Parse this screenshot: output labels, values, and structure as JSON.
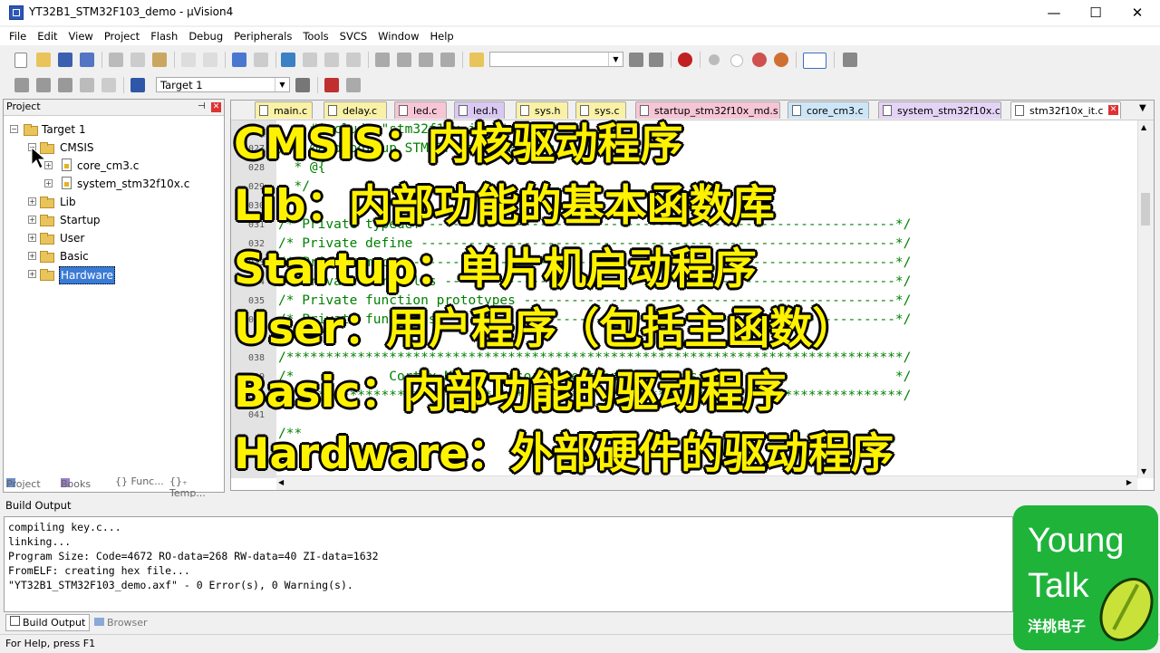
{
  "window": {
    "title": "YT32B1_STM32F103_demo - µVision4",
    "minimize": "—",
    "maximize": "☐",
    "close": "✕"
  },
  "menu": [
    "File",
    "Edit",
    "View",
    "Project",
    "Flash",
    "Debug",
    "Peripherals",
    "Tools",
    "SVCS",
    "Window",
    "Help"
  ],
  "toolbar2": {
    "target": "Target 1"
  },
  "project_panel": {
    "title": "Project",
    "tree": [
      {
        "label": "Target 1"
      },
      {
        "label": "CMSIS"
      },
      {
        "label": "core_cm3.c"
      },
      {
        "label": "system_stm32f10x.c"
      },
      {
        "label": "Lib"
      },
      {
        "label": "Startup"
      },
      {
        "label": "User"
      },
      {
        "label": "Basic"
      },
      {
        "label": "Hardware"
      }
    ],
    "tabs": [
      "Project",
      "Books",
      "{} Func...",
      "{}₊ Temp..."
    ]
  },
  "editor": {
    "tabs": [
      {
        "label": "main.c",
        "color": "#f9f1a6"
      },
      {
        "label": "delay.c",
        "color": "#f9f1a6"
      },
      {
        "label": "led.c",
        "color": "#f6c5d6"
      },
      {
        "label": "led.h",
        "color": "#d9c9f2"
      },
      {
        "label": "sys.h",
        "color": "#f9f1a6"
      },
      {
        "label": "sys.c",
        "color": "#f9f1a6"
      },
      {
        "label": "startup_stm32f10x_md.s",
        "color": "#f6c5d6"
      },
      {
        "label": "core_cm3.c",
        "color": "#cde6f7"
      },
      {
        "label": "system_stm32f10x.c",
        "color": "#e3d3f4"
      },
      {
        "label": "stm32f10x_it.c",
        "color": "#ffffff"
      }
    ],
    "lines": [
      {
        "num": "",
        "text": "    #include \"stm32f10x_it.h\""
      },
      {
        "num": "027",
        "text": "/** @addtogroup STM32F10x_StdPeriph_Template"
      },
      {
        "num": "028",
        "text": "  * @{"
      },
      {
        "num": "029",
        "text": "  */"
      },
      {
        "num": "030",
        "text": ""
      },
      {
        "num": "031",
        "text": "/* Private typedef -----------------------------------------------------------*/"
      },
      {
        "num": "032",
        "text": "/* Private define ------------------------------------------------------------*/"
      },
      {
        "num": "033",
        "text": "/* Private macro -------------------------------------------------------------*/"
      },
      {
        "num": "034",
        "text": "/* Private variables ---------------------------------------------------------*/"
      },
      {
        "num": "035",
        "text": "/* Private function prototypes -----------------------------------------------*/"
      },
      {
        "num": "036",
        "text": "/* Private functions ---------------------------------------------------------*/"
      },
      {
        "num": "037",
        "text": ""
      },
      {
        "num": "038",
        "text": "/******************************************************************************/"
      },
      {
        "num": "039",
        "text": "/*            Cortex-M3 Processor Exceptions Handlers                         */"
      },
      {
        "num": "040",
        "text": "/******************************************************************************/"
      },
      {
        "num": "041",
        "text": ""
      },
      {
        "num": "",
        "text": "/**"
      }
    ]
  },
  "overlay": [
    "CMSIS：内核驱动程序",
    "Lib：内部功能的基本函数库",
    "Startup：单片机启动程序",
    "User：用户程序（包括主函数）",
    "Basic：内部功能的驱动程序",
    "Hardware：外部硬件的驱动程序"
  ],
  "build_output": {
    "title": "Build Output",
    "lines": [
      "compiling key.c...",
      "linking...",
      "Program Size: Code=4672 RO-data=268 RW-data=40 ZI-data=1632",
      "FromELF: creating hex file...",
      "\"YT32B1_STM32F103_demo.axf\" - 0 Error(s), 0 Warning(s)."
    ],
    "tabs": [
      "Build Output",
      "Browser"
    ]
  },
  "status_bar": {
    "text": "For Help, press F1"
  },
  "logo": {
    "line1": "Young",
    "line2": "Talk",
    "line3": "洋桃电子"
  }
}
